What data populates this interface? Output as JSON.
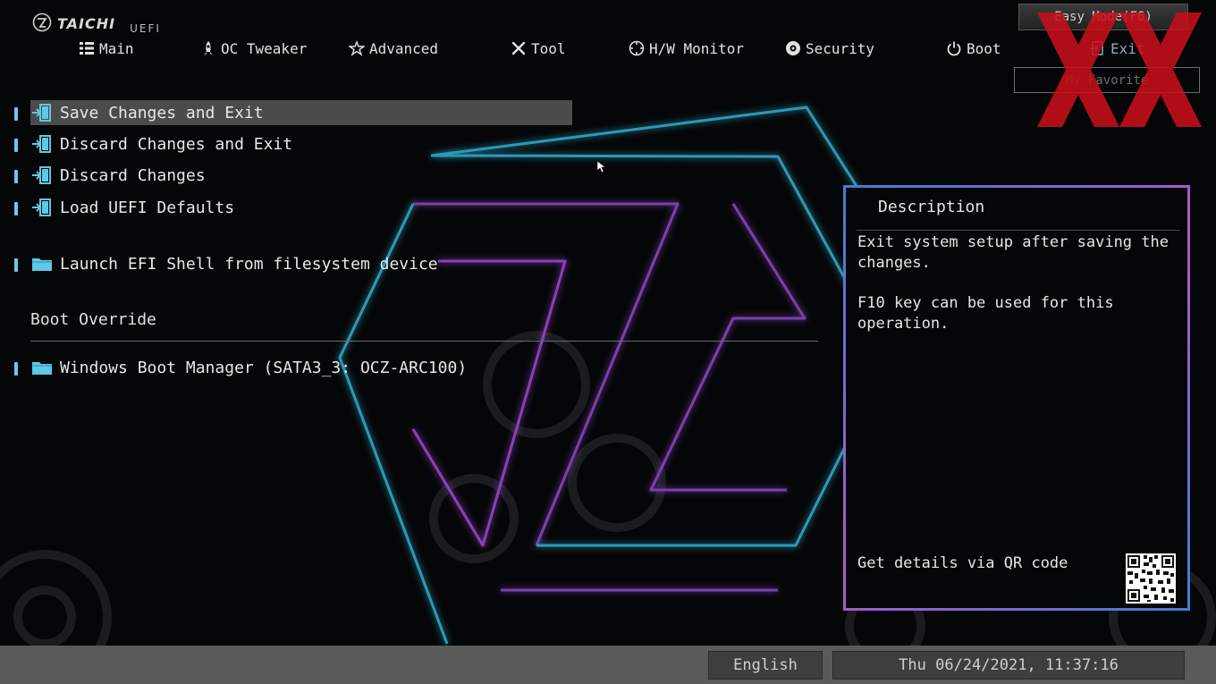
{
  "brand": {
    "name": "TAICHI",
    "product": "UEFI"
  },
  "nav": {
    "tabs": [
      {
        "label": "Main",
        "icon": "list-icon"
      },
      {
        "label": "OC Tweaker",
        "icon": "rocket-icon"
      },
      {
        "label": "Advanced",
        "icon": "star-icon"
      },
      {
        "label": "Tool",
        "icon": "tools-icon"
      },
      {
        "label": "H/W Monitor",
        "icon": "crosshair-icon"
      },
      {
        "label": "Security",
        "icon": "shield-icon"
      },
      {
        "label": "Boot",
        "icon": "power-icon"
      },
      {
        "label": "Exit",
        "icon": "exit-icon",
        "active": true
      }
    ],
    "easy_mode_label": "Easy Mode(F6)",
    "favorite_label": "My Favorite"
  },
  "menu": {
    "items": [
      {
        "label": "Save Changes and Exit",
        "icon": "exit-door-icon",
        "selected": true
      },
      {
        "label": "Discard Changes and Exit",
        "icon": "exit-door-icon"
      },
      {
        "label": "Discard Changes",
        "icon": "exit-door-icon"
      },
      {
        "label": "Load UEFI Defaults",
        "icon": "exit-door-icon"
      },
      {
        "label": "Launch EFI Shell from filesystem device",
        "icon": "folder-icon"
      }
    ],
    "boot_override": {
      "title": "Boot Override",
      "items": [
        {
          "label": "Windows Boot Manager (SATA3_3: OCZ-ARC100)",
          "icon": "folder-icon"
        }
      ]
    }
  },
  "description": {
    "title": "Description",
    "paragraphs": [
      "Exit system setup after saving the changes.",
      "F10 key can be used for this operation."
    ],
    "qr_text": "Get details via QR code"
  },
  "footer": {
    "language": "English",
    "datetime": "Thu 06/24/2021, 11:37:16"
  },
  "colors": {
    "accent_cyan": "#35c6e0",
    "accent_magenta": "#b455c9",
    "selected_row": "#4b4b4b",
    "watermark_red": "#c8101a"
  }
}
